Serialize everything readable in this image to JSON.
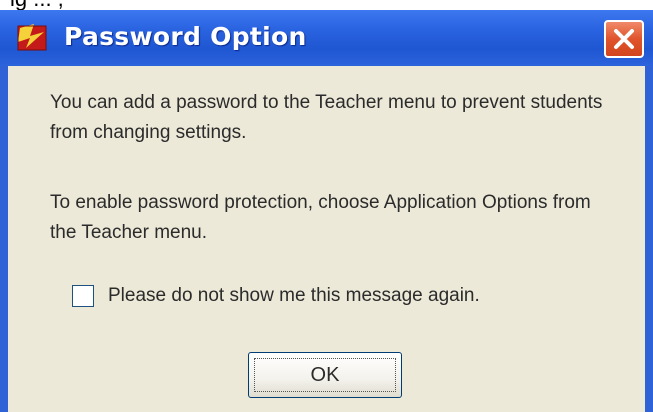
{
  "page_header_fragment": "ig ... ,",
  "window": {
    "title": "Password Option",
    "icon": "app-red-yellow-icon",
    "close_icon": "close-icon",
    "colors": {
      "titlebar": "#2a63e0",
      "close_button": "#e0542c",
      "client": "#ece9d8"
    }
  },
  "dialog": {
    "message_1": "You can add a password to the Teacher menu to prevent students from changing settings.",
    "message_2": "To enable password protection, choose Application Options from the Teacher menu.",
    "checkbox": {
      "label": "Please do not show me this message again.",
      "checked": false
    },
    "ok_label": "OK"
  }
}
